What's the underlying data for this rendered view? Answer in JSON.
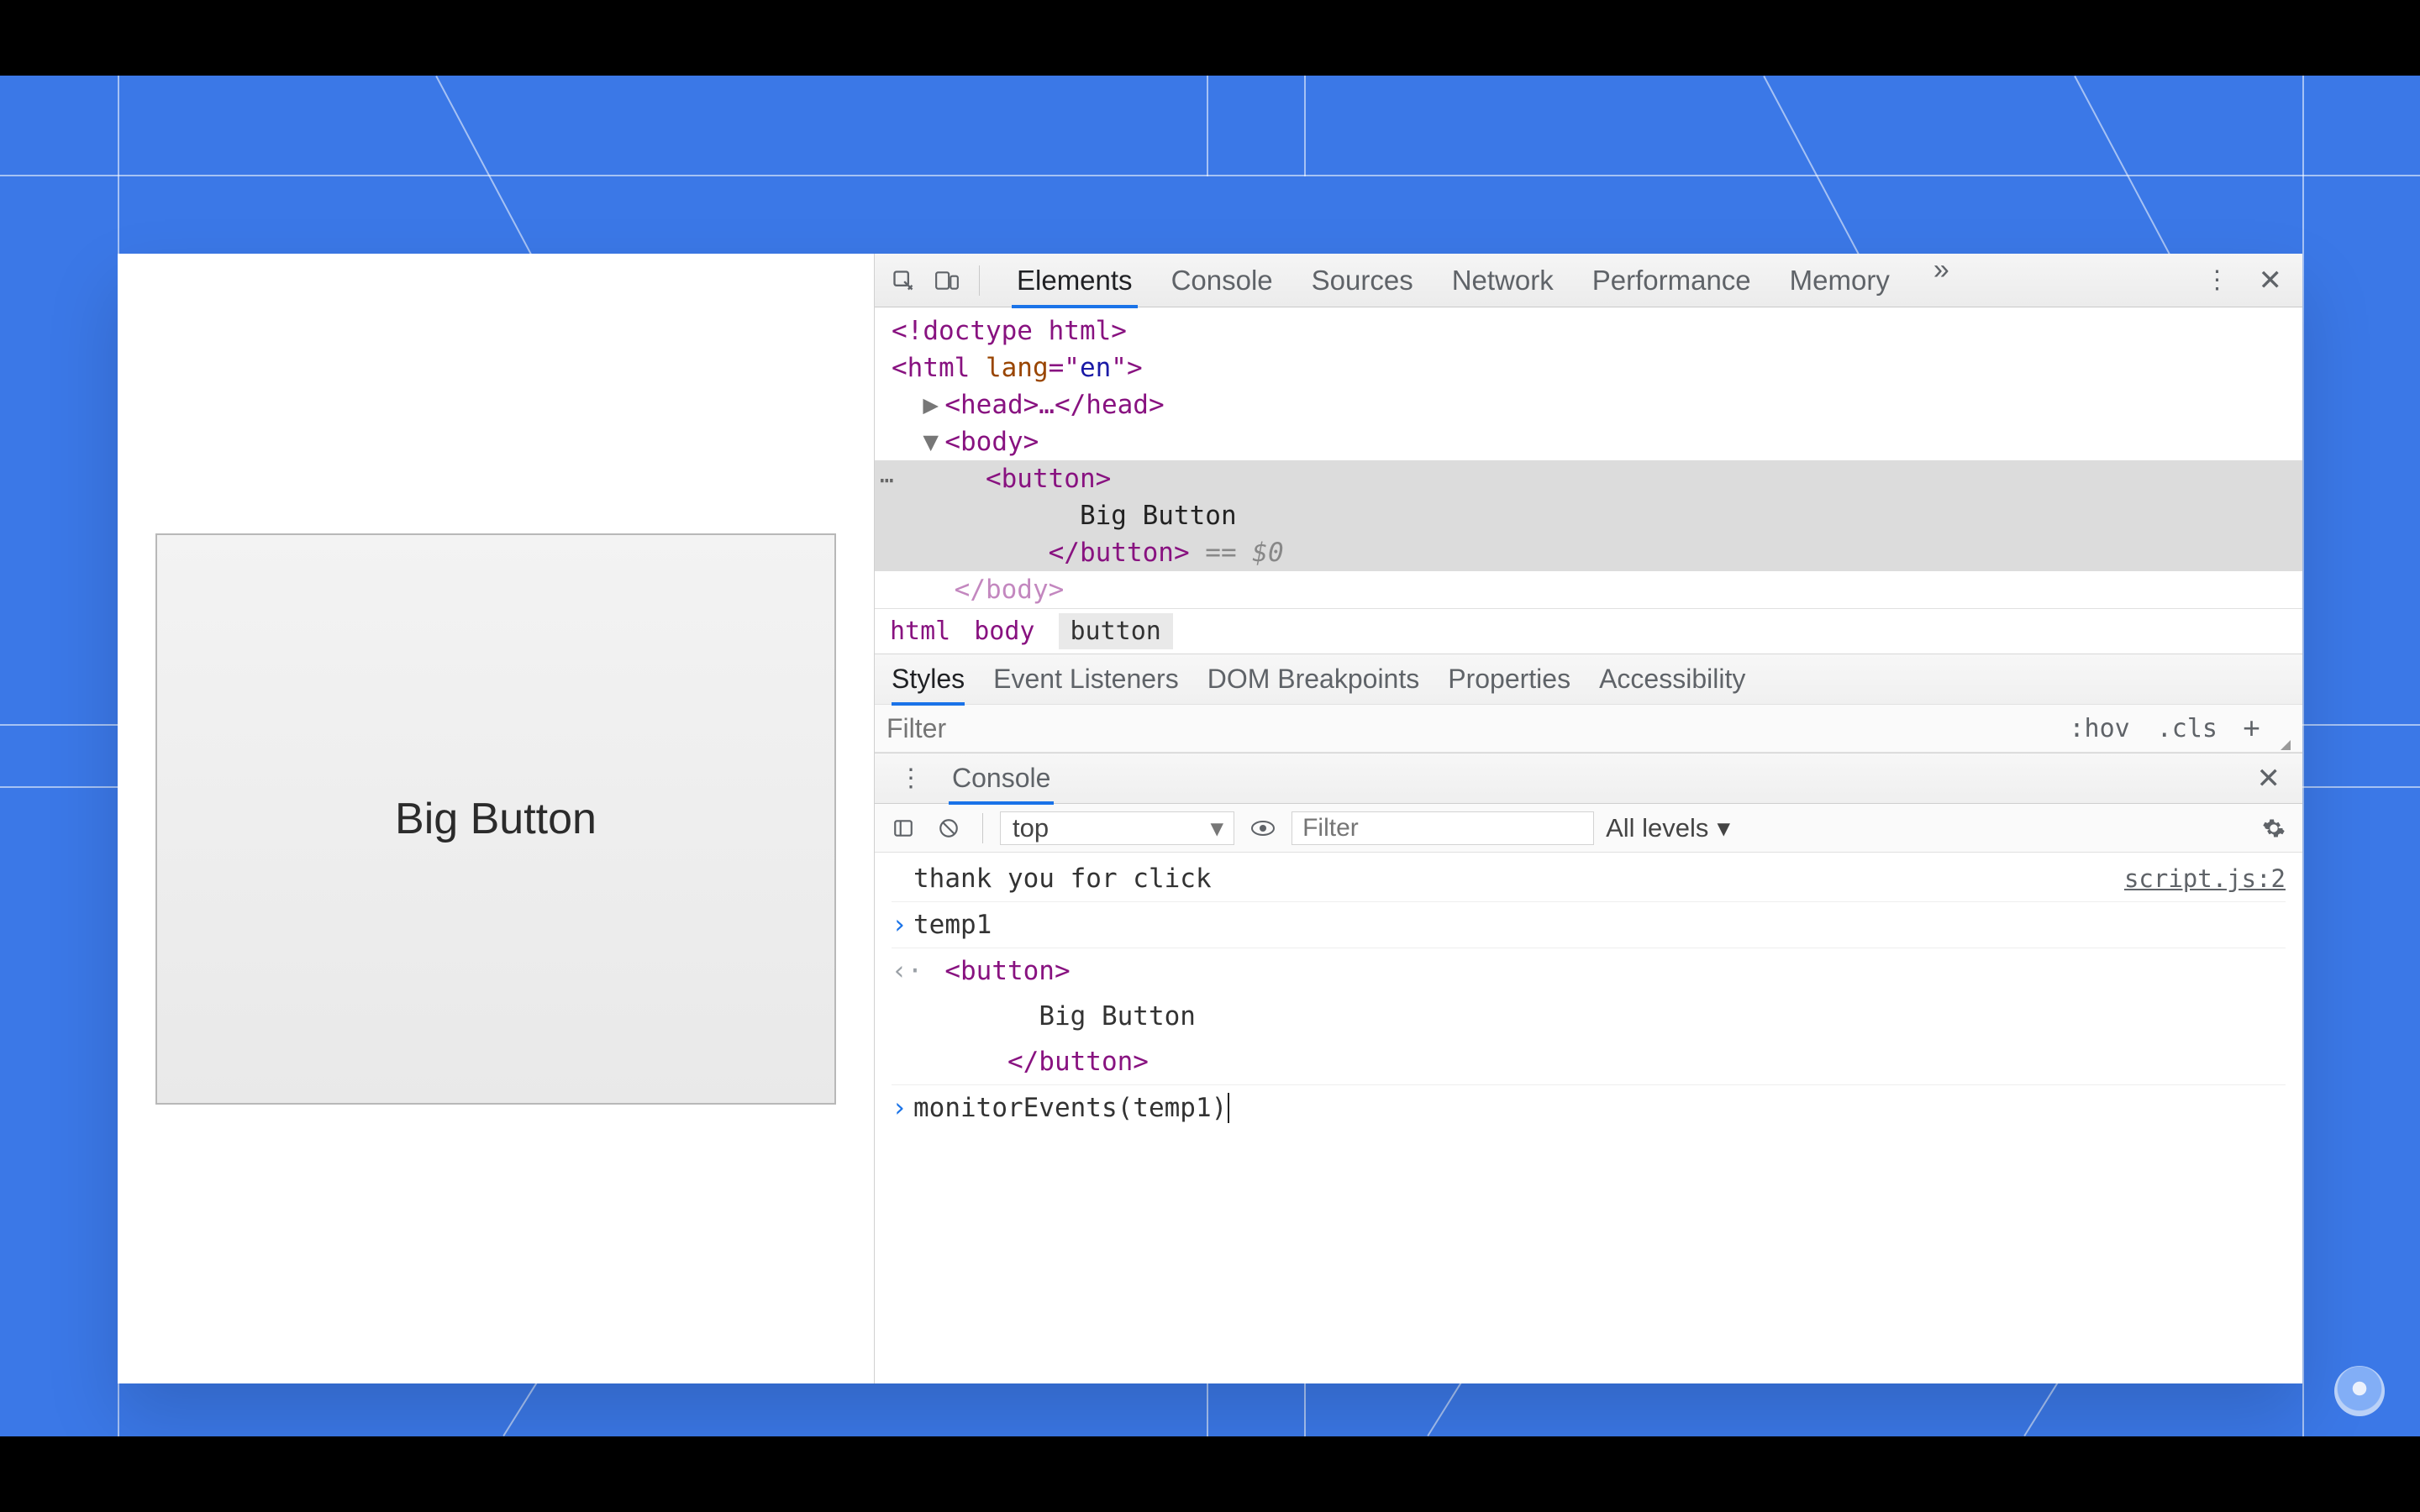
{
  "page": {
    "bigButtonLabel": "Big Button"
  },
  "devtools": {
    "tabs": [
      "Elements",
      "Console",
      "Sources",
      "Network",
      "Performance",
      "Memory"
    ],
    "activeTabIndex": 0,
    "dom": {
      "doctype": "<!doctype html>",
      "htmlOpen": "<html lang=\"en\">",
      "headCollapsed": "<head>…</head>",
      "bodyOpen": "<body>",
      "buttonOpen": "<button>",
      "buttonText": "Big Button",
      "buttonClose": "</button>",
      "refHint": "== $0",
      "bodyClosePartial": "</body>"
    },
    "breadcrumb": [
      "html",
      "body",
      "button"
    ],
    "stylesTabs": [
      "Styles",
      "Event Listeners",
      "DOM Breakpoints",
      "Properties",
      "Accessibility"
    ],
    "stylesActiveIndex": 0,
    "filter": {
      "placeholder": "Filter",
      "hov": ":hov",
      "cls": ".cls"
    },
    "consoleDrawer": {
      "title": "Console",
      "context": "top",
      "filterPlaceholder": "Filter",
      "levels": "All levels",
      "log": {
        "text": "thank you for click",
        "source": "script.js:2"
      },
      "entries": {
        "temp1": "temp1",
        "outOpen": "<button>",
        "outText": "Big Button",
        "outClose": "</button>",
        "input": "monitorEvents(temp1)"
      }
    }
  }
}
